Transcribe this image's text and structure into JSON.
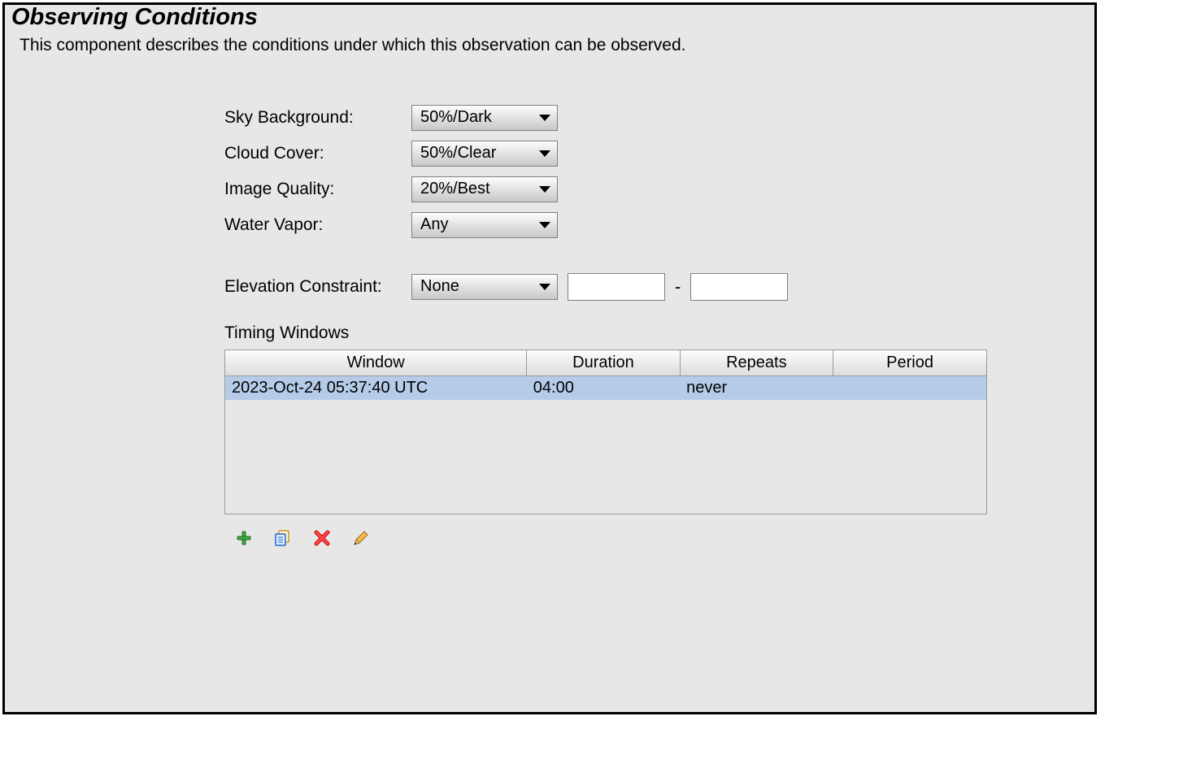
{
  "title": "Observing Conditions",
  "description": "This component describes the conditions under which this observation can be observed.",
  "fields": {
    "sky_background": {
      "label": "Sky Background:",
      "value": "50%/Dark"
    },
    "cloud_cover": {
      "label": "Cloud Cover:",
      "value": "50%/Clear"
    },
    "image_quality": {
      "label": "Image Quality:",
      "value": "20%/Best"
    },
    "water_vapor": {
      "label": "Water Vapor:",
      "value": "Any"
    },
    "elevation": {
      "label": "Elevation Constraint:",
      "value": "None",
      "min": "",
      "max": "",
      "sep": "-"
    }
  },
  "timing": {
    "label": "Timing Windows",
    "headers": {
      "window": "Window",
      "duration": "Duration",
      "repeats": "Repeats",
      "period": "Period"
    },
    "rows": [
      {
        "window": "2023-Oct-24 05:37:40 UTC",
        "duration": "04:00",
        "repeats": "never",
        "period": ""
      }
    ]
  }
}
